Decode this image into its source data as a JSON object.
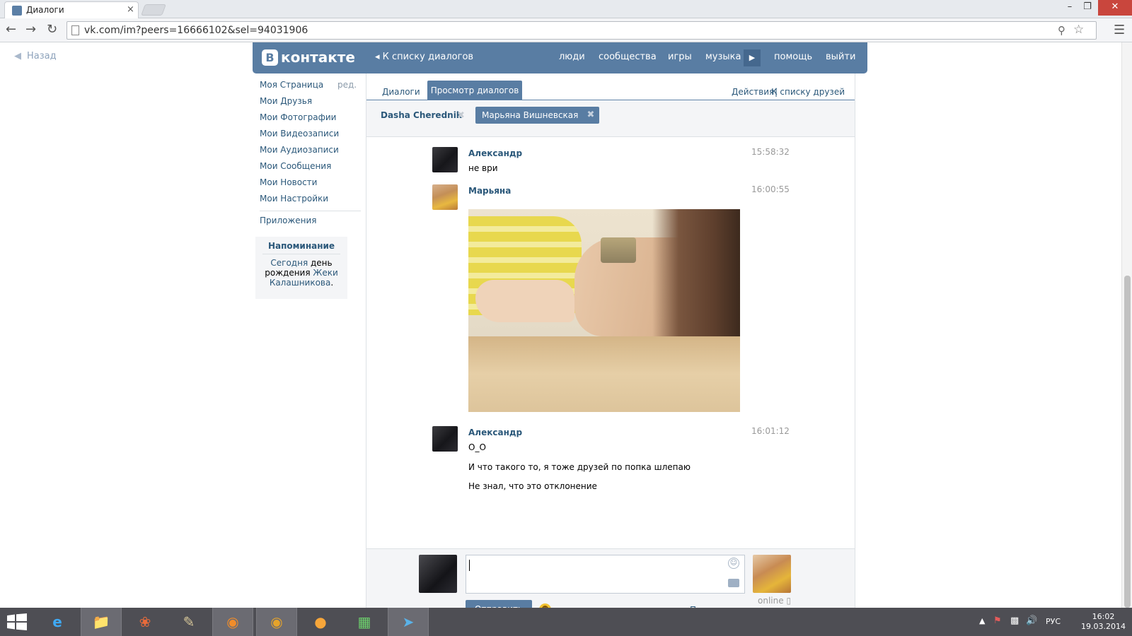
{
  "browser": {
    "tab_title": "Диалоги",
    "url": "vk.com/im?peers=16666102&sel=94031906",
    "close_glyph": "×",
    "min_glyph": "–",
    "max_glyph": "❐",
    "win_close_glyph": "✕"
  },
  "page": {
    "back_label": "Назад",
    "logo_letter": "В",
    "logo_text": "контакте",
    "to_dialogs": "К списку диалогов",
    "nav": {
      "people": "люди",
      "groups": "сообщества",
      "games": "игры",
      "music": "музыка",
      "help": "помощь",
      "logout": "выйти"
    },
    "left_menu": {
      "items": [
        "Моя Страница",
        "Мои Друзья",
        "Мои Фотографии",
        "Мои Видеозаписи",
        "Мои Аудиозаписи",
        "Мои Сообщения",
        "Мои Новости",
        "Мои Настройки"
      ],
      "edit": "ред.",
      "apps": "Приложения"
    },
    "reminder": {
      "title": "Напоминание",
      "today": "Сегодня",
      "birthday": "день рождения",
      "name": "Жеки Калашникова",
      "dot": "."
    }
  },
  "dialog": {
    "tabs": {
      "dialogs": "Диалоги",
      "view": "Просмотр диалогов",
      "actions": "Действия",
      "sep": "|",
      "friends": "К списку друзей"
    },
    "peers": [
      "Dasha Cherednik",
      "Марьяна Вишневская"
    ],
    "messages": [
      {
        "author": "Александр",
        "time": "15:58:32",
        "lines": [
          "не ври"
        ]
      },
      {
        "author": "Марьяна",
        "time": "16:00:55",
        "lines": []
      },
      {
        "author": "Александр",
        "time": "16:01:12",
        "lines": [
          "О_О",
          "И что такого то, я тоже друзей по попка шлепаю",
          "Не знал, что это отклонение"
        ]
      }
    ],
    "compose": {
      "send": "Отправить",
      "attach": "Прикрепить",
      "online": "online"
    }
  },
  "taskbar": {
    "lang": "РУС",
    "time": "16:02",
    "date": "19.03.2014"
  },
  "colors": {
    "vk_blue": "#597da3",
    "link": "#2b587a",
    "taskbar": "#4e4e54"
  }
}
